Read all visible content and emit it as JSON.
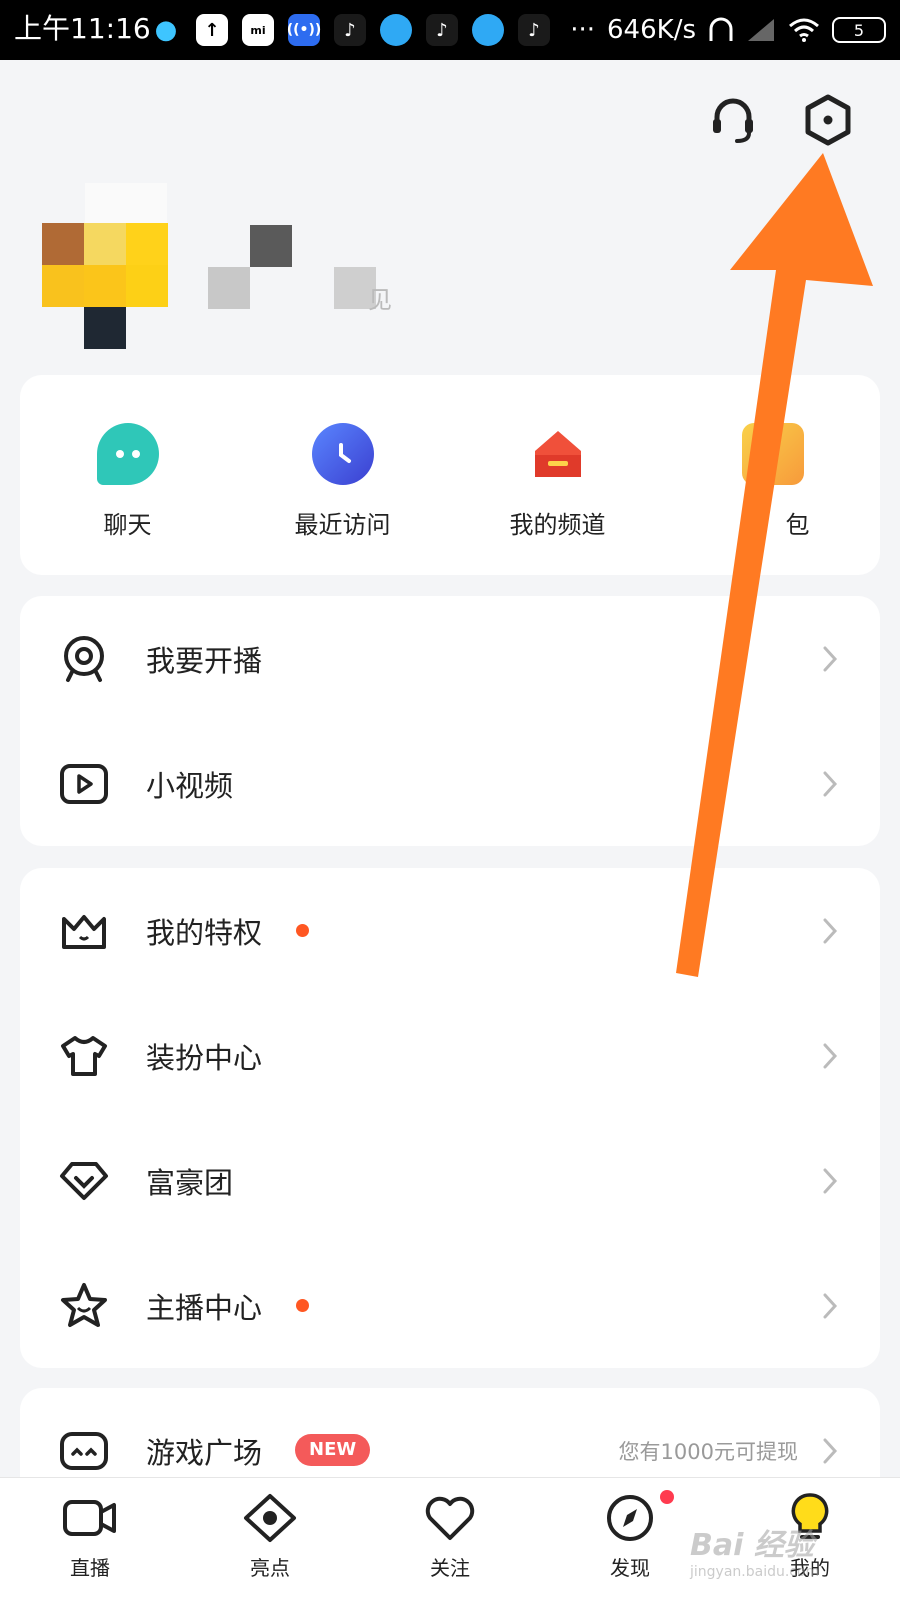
{
  "status_bar": {
    "time": "上午11:16",
    "speed": "646K/s",
    "battery": "5",
    "more": "···"
  },
  "quick_actions": [
    {
      "label": "聊天",
      "icon": "chat-bubble-icon",
      "color": "#2fc7b8"
    },
    {
      "label": "最近访问",
      "icon": "clock-icon",
      "color": "#4a63f0"
    },
    {
      "label": "我的频道",
      "icon": "house-icon",
      "color": "#f0503a"
    },
    {
      "label": "包",
      "icon": "wallet-icon",
      "color": "#f7b23b"
    }
  ],
  "menu_group_1": [
    {
      "label": "我要开播",
      "icon": "webcam-icon"
    },
    {
      "label": "小视频",
      "icon": "play-video-icon"
    }
  ],
  "menu_group_2": [
    {
      "label": "我的特权",
      "icon": "crown-icon",
      "dot": true
    },
    {
      "label": "装扮中心",
      "icon": "tshirt-icon",
      "dot": false
    },
    {
      "label": "富豪团",
      "icon": "diamond-icon",
      "dot": false
    },
    {
      "label": "主播中心",
      "icon": "star-icon",
      "dot": true
    }
  ],
  "menu_group_3": [
    {
      "label": "游戏广场",
      "icon": "gamepad-icon",
      "badge": "NEW",
      "hint": "您有1000元可提现"
    }
  ],
  "tabs": [
    {
      "label": "直播",
      "icon": "video-camera-icon"
    },
    {
      "label": "亮点",
      "icon": "eye-icon"
    },
    {
      "label": "关注",
      "icon": "heart-icon"
    },
    {
      "label": "发现",
      "icon": "compass-icon",
      "dot": true
    },
    {
      "label": "我的",
      "icon": "lightbulb-icon",
      "active": true
    }
  ],
  "profile": {
    "name_partial": "见"
  },
  "watermark": {
    "text": "Bai 经验",
    "sub": "jingyan.baidu.com"
  },
  "colors": {
    "accent": "#ff5722",
    "arrow": "#ff7a22",
    "new_badge": "#f45a5a"
  }
}
